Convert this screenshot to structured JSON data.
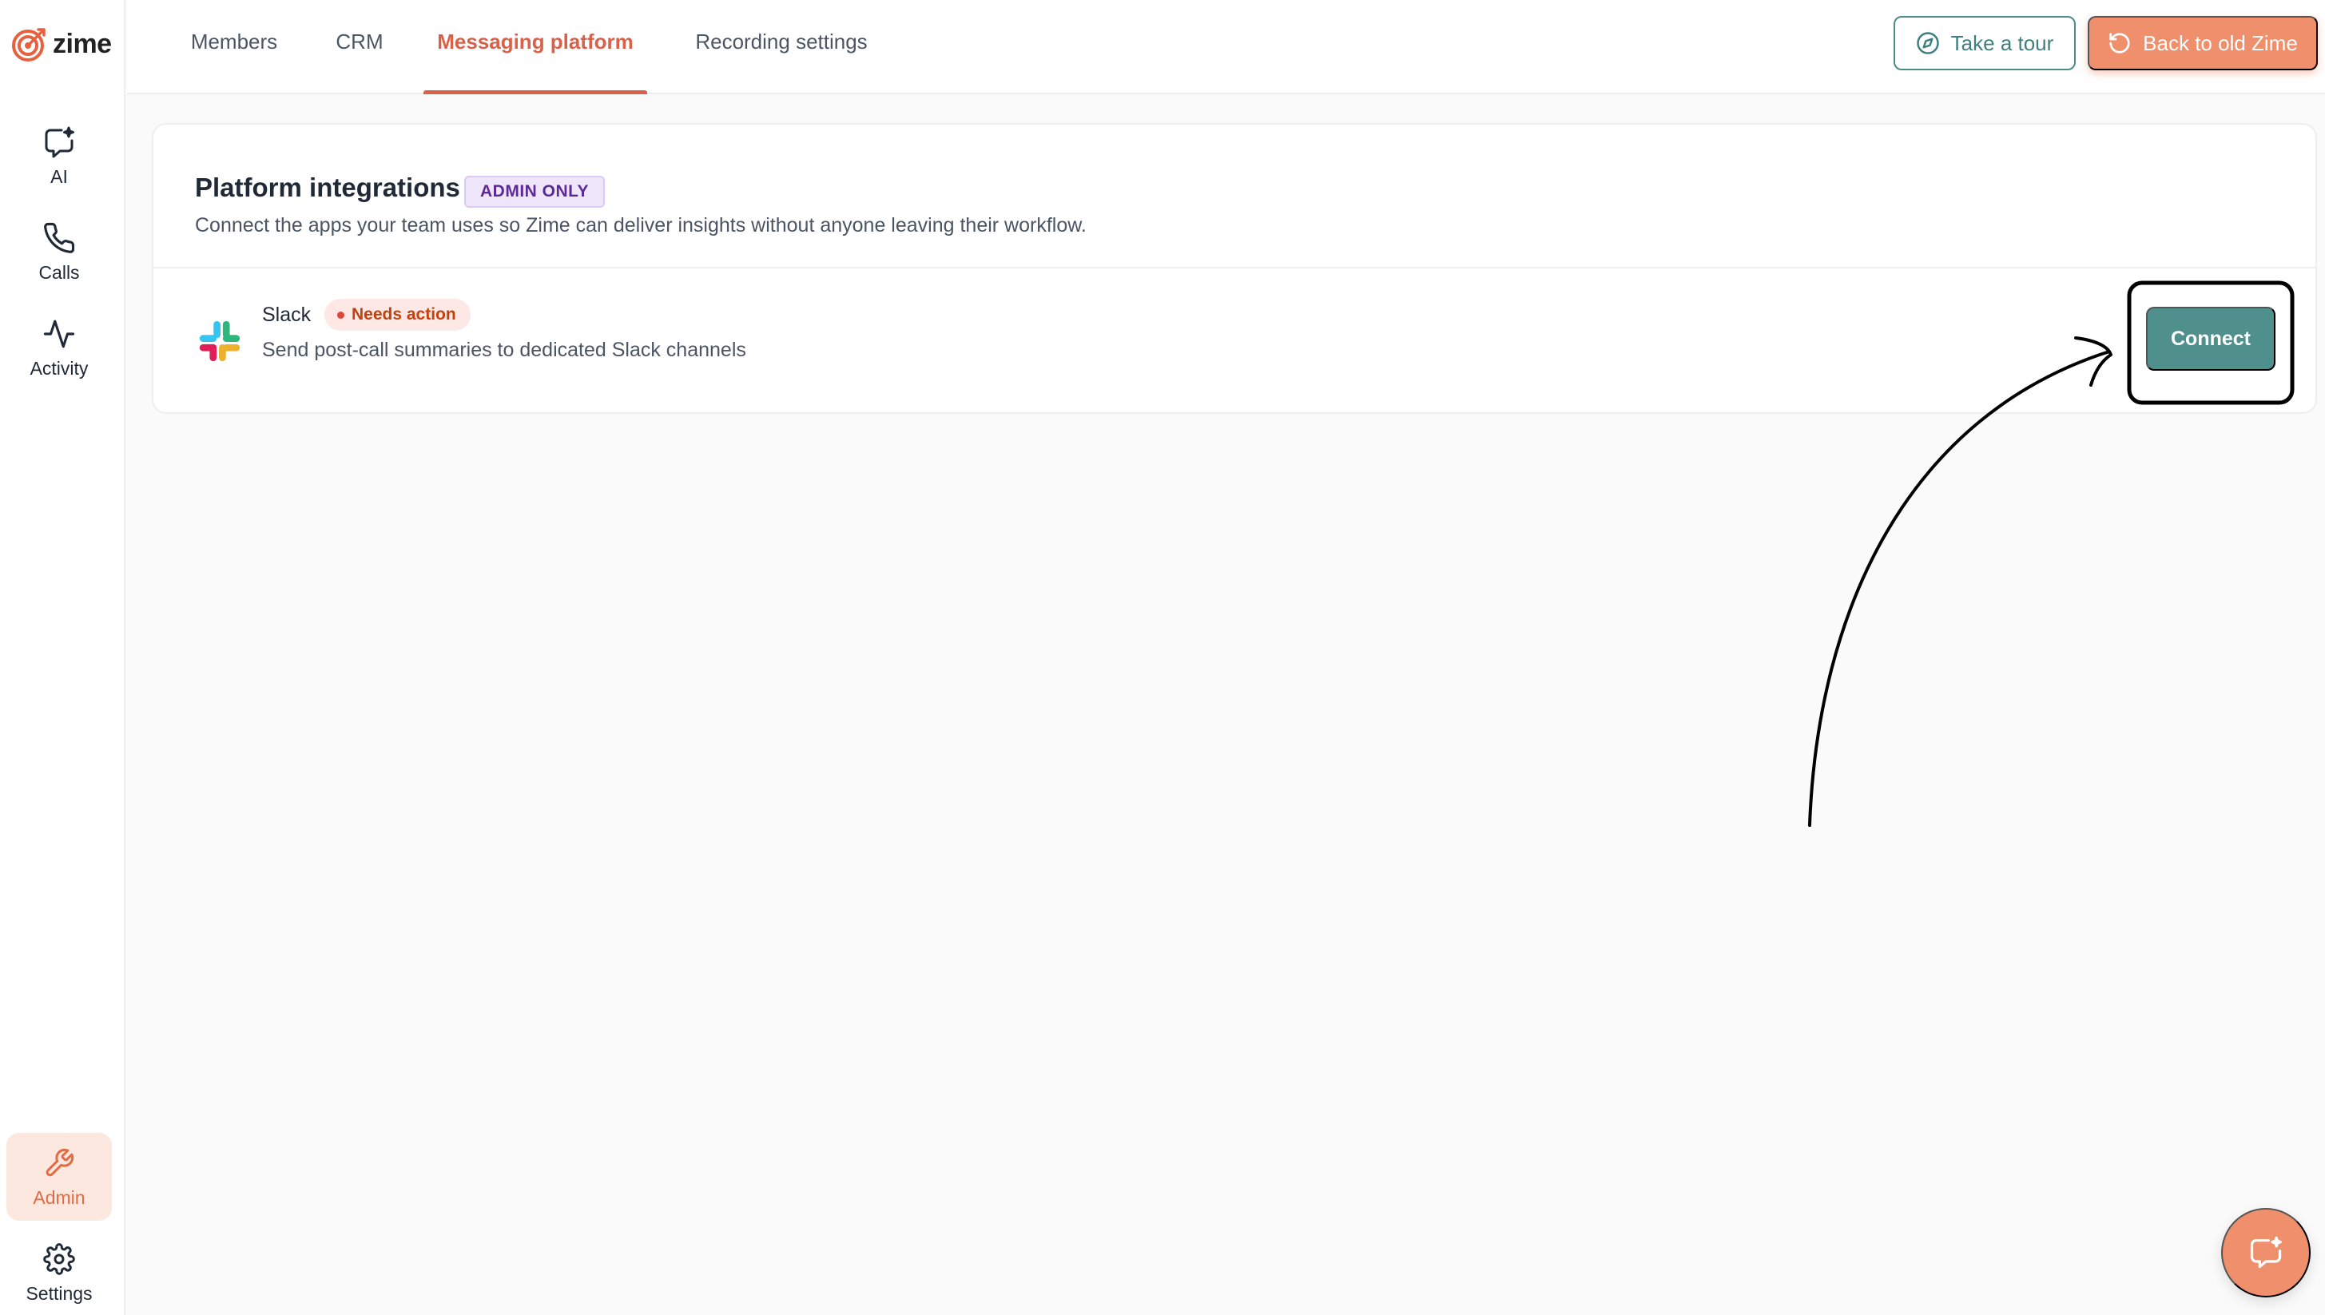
{
  "brand": {
    "name": "zime",
    "accent": "#e06b44"
  },
  "sidebar": {
    "items": [
      {
        "label": "AI",
        "icon": "ai-chat-icon"
      },
      {
        "label": "Calls",
        "icon": "phone-icon"
      },
      {
        "label": "Activity",
        "icon": "activity-icon"
      }
    ],
    "bottom_items": [
      {
        "label": "Admin",
        "icon": "wrench-icon",
        "active": true
      },
      {
        "label": "Settings",
        "icon": "gear-icon"
      }
    ]
  },
  "tabs": [
    {
      "label": "Members"
    },
    {
      "label": "CRM"
    },
    {
      "label": "Messaging platform",
      "active": true
    },
    {
      "label": "Recording settings"
    }
  ],
  "header_actions": {
    "tour_label": "Take a tour",
    "back_label": "Back to old Zime"
  },
  "card": {
    "title": "Platform integrations",
    "badge": "ADMIN ONLY",
    "subtitle": "Connect the apps your team uses so Zime can deliver insights without anyone leaving their workflow."
  },
  "integrations": [
    {
      "name": "Slack",
      "status": "Needs action",
      "description": "Send post-call summaries to dedicated Slack channels",
      "action_label": "Connect"
    }
  ],
  "colors": {
    "teal": "#4f8f8c",
    "orange": "#ef8f6c",
    "active_tab": "#d9614a"
  }
}
